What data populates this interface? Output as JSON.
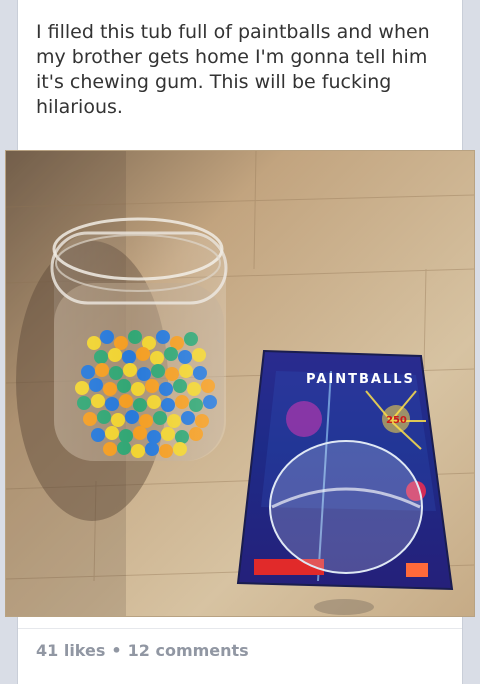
{
  "post": {
    "text": "I filled this tub full of paintballs and when my brother gets home I'm gonna tell him it's chewing gum. This will be fucking hilarious.",
    "photo_alt": "",
    "likes": "41 likes",
    "separator": "•",
    "comments": "12 comments"
  },
  "photo_packaging": {
    "brand_text": "PAINTBALLS",
    "badge_text": "250"
  },
  "colors": {
    "page_background": "#d9dde6",
    "card_background": "#ffffff",
    "text": "#333333",
    "meta_text": "#9197a3"
  }
}
